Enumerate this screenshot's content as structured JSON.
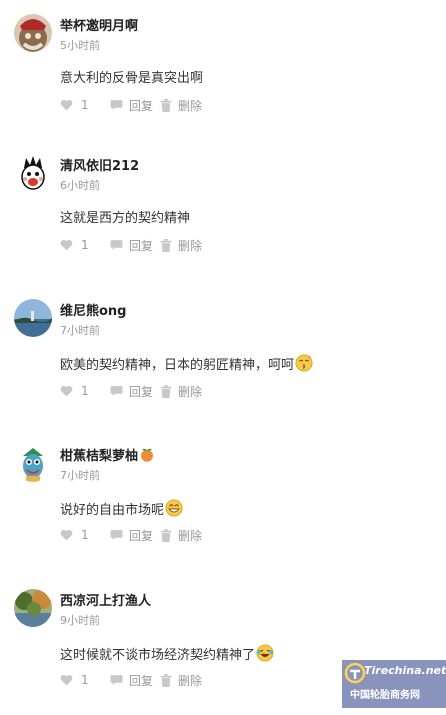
{
  "comments": [
    {
      "username": "举杯邀明月啊",
      "time": "5小时前",
      "content": "意大利的反骨是真突出啊",
      "likes": "1",
      "reply_label": "回复",
      "delete_label": "删除",
      "emoji": "",
      "avatar_color": "#8a6b4e"
    },
    {
      "username": "清风依旧212",
      "time": "6小时前",
      "content": "这就是西方的契约精神",
      "likes": "1",
      "reply_label": "回复",
      "delete_label": "删除",
      "emoji": "",
      "avatar_color": "#f5f5f5"
    },
    {
      "username": "维尼熊ong",
      "time": "7小时前",
      "content": "欧美的契约精神，日本的躬匠精神，呵呵",
      "likes": "1",
      "reply_label": "回复",
      "delete_label": "删除",
      "emoji": "kiss-emoji",
      "avatar_color": "#6f9ac2"
    },
    {
      "username": "柑蕉桔梨萝柚",
      "time": "7小时前",
      "content": "说好的自由市场呢",
      "likes": "1",
      "reply_label": "回复",
      "delete_label": "删除",
      "emoji": "grin-emoji",
      "avatar_color": "#4aa3c9"
    },
    {
      "username": "西凉河上打渔人",
      "time": "9小时前",
      "content": "这时候就不谈市场经济契约精神了",
      "likes": "1",
      "reply_label": "回复",
      "delete_label": "删除",
      "emoji": "laugh-tears-emoji",
      "avatar_color": "#6b8a3e"
    }
  ],
  "watermark": {
    "brand": "Tirechina.net",
    "caption": "中国轮胎商务网"
  }
}
